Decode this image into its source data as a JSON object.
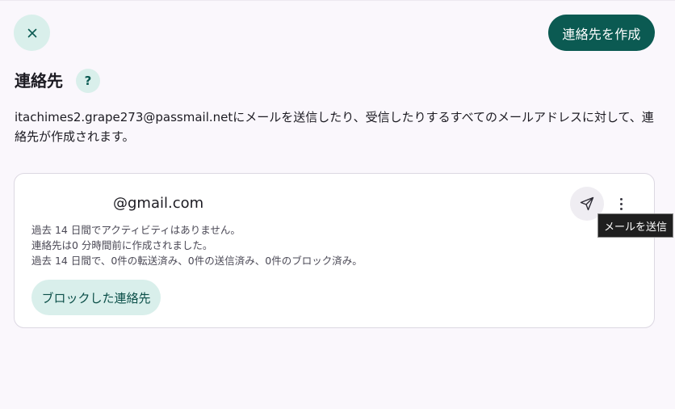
{
  "header": {
    "close_icon": "close-icon",
    "create_button_label": "連絡先を作成"
  },
  "section": {
    "title": "連絡先",
    "help_label": "?",
    "description": "itachimes2.grape273@passmail.netにメールを送信したり、受信したりするすべてのメールアドレスに対して、連絡先が作成されます。"
  },
  "contact_card": {
    "email": "@gmail.com",
    "activity_line": "過去 14 日間でアクティビティはありません。",
    "created_line": "連絡先は0 分時間前に作成されました。",
    "stats_line": "過去 14 日間で、0件の転送済み、0件の送信済み、0件のブロック済み。",
    "blocked_button_label": "ブロックした連絡先",
    "send_icon": "send-icon",
    "more_icon": "more-vertical-icon"
  },
  "tooltip": {
    "text": "メールを送信"
  },
  "colors": {
    "accent": "#0b5a52",
    "accent_light": "#d9efeb",
    "background": "#faf7fc"
  }
}
